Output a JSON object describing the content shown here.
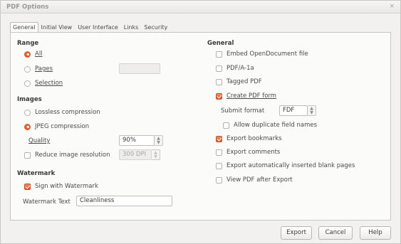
{
  "window": {
    "title": "PDF Options",
    "close_glyph": "×"
  },
  "tabs": [
    {
      "label": "General",
      "active": true
    },
    {
      "label": "Initial View",
      "active": false
    },
    {
      "label": "User Interface",
      "active": false
    },
    {
      "label": "Links",
      "active": false
    },
    {
      "label": "Security",
      "active": false
    }
  ],
  "range": {
    "heading": "Range",
    "all": {
      "label": "All",
      "selected": true
    },
    "pages": {
      "label": "Pages",
      "selected": false,
      "value": ""
    },
    "selection": {
      "label": "Selection",
      "selected": false
    }
  },
  "images": {
    "heading": "Images",
    "lossless": {
      "label": "Lossless compression",
      "selected": false
    },
    "jpeg": {
      "label": "JPEG compression",
      "selected": true
    },
    "quality": {
      "label": "Quality",
      "value": "90%"
    },
    "reduce": {
      "label": "Reduce image resolution",
      "checked": false,
      "value": "300 DPI"
    }
  },
  "watermark": {
    "heading": "Watermark",
    "sign": {
      "label": "Sign with Watermark",
      "checked": true
    },
    "text": {
      "label": "Watermark Text",
      "value": "Cleanliness"
    }
  },
  "general": {
    "heading": "General",
    "embed": {
      "label": "Embed OpenDocument file",
      "checked": false
    },
    "pdfa": {
      "label": "PDF/A-1a",
      "checked": false
    },
    "tagged": {
      "label": "Tagged PDF",
      "checked": false
    },
    "create_form": {
      "label": "Create PDF form",
      "checked": true
    },
    "submit_format": {
      "label": "Submit format",
      "value": "FDF"
    },
    "allow_duplicate": {
      "label": "Allow duplicate field names",
      "checked": false
    },
    "export_bookmarks": {
      "label": "Export bookmarks",
      "checked": true
    },
    "export_comments": {
      "label": "Export comments",
      "checked": false
    },
    "export_blank": {
      "label": "Export automatically inserted blank pages",
      "checked": false
    },
    "view_after": {
      "label": "View PDF after Export",
      "checked": false
    }
  },
  "buttons": {
    "export": "Export",
    "cancel": "Cancel",
    "help": "Help"
  },
  "colors": {
    "accent": "#dd5a2e",
    "window_bg": "#f2f1f0",
    "panel_bg": "#fbfbfa"
  }
}
